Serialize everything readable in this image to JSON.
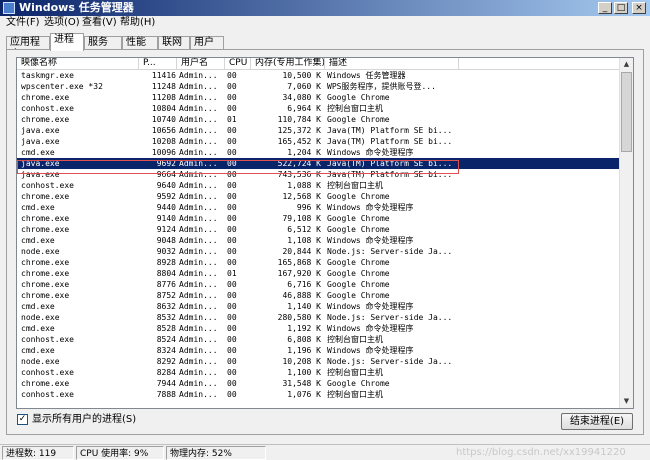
{
  "window": {
    "title": "Windows 任务管理器",
    "min_glyph": "_",
    "max_glyph": "□",
    "close_glyph": "×"
  },
  "menu": [
    "文件(F)",
    "选项(O)",
    "查看(V)",
    "帮助(H)"
  ],
  "tabs": [
    "应用程序",
    "进程",
    "服务",
    "性能",
    "联网",
    "用户"
  ],
  "table": {
    "headers": [
      "映像名称",
      "P...",
      "用户名",
      "CPU",
      "内存(专用工作集)",
      "描述"
    ],
    "rows": [
      {
        "name": "taskmgr.exe",
        "pid": "11416",
        "user": "Admin...",
        "cpu": "00",
        "mem": "10,500 K",
        "desc": "Windows 任务管理器"
      },
      {
        "name": "wpscenter.exe *32",
        "pid": "11248",
        "user": "Admin...",
        "cpu": "00",
        "mem": "7,060 K",
        "desc": "WPS服务程序，提供账号登..."
      },
      {
        "name": "chrome.exe",
        "pid": "11208",
        "user": "Admin...",
        "cpu": "00",
        "mem": "34,080 K",
        "desc": "Google Chrome"
      },
      {
        "name": "conhost.exe",
        "pid": "10804",
        "user": "Admin...",
        "cpu": "00",
        "mem": "6,964 K",
        "desc": "控制台窗口主机"
      },
      {
        "name": "chrome.exe",
        "pid": "10740",
        "user": "Admin...",
        "cpu": "01",
        "mem": "110,784 K",
        "desc": "Google Chrome"
      },
      {
        "name": "java.exe",
        "pid": "10656",
        "user": "Admin...",
        "cpu": "00",
        "mem": "125,372 K",
        "desc": "Java(TM) Platform SE bi..."
      },
      {
        "name": "java.exe",
        "pid": "10208",
        "user": "Admin...",
        "cpu": "00",
        "mem": "165,452 K",
        "desc": "Java(TM) Platform SE bi..."
      },
      {
        "name": "cmd.exe",
        "pid": "10096",
        "user": "Admin...",
        "cpu": "00",
        "mem": "1,204 K",
        "desc": "Windows 命令处理程序"
      },
      {
        "name": "java.exe",
        "pid": "9692",
        "user": "Admin...",
        "cpu": "00",
        "mem": "522,724 K",
        "desc": "Java(TM) Platform SE bi..."
      },
      {
        "name": "java.exe",
        "pid": "9664",
        "user": "Admin...",
        "cpu": "00",
        "mem": "743,536 K",
        "desc": "Java(TM) Platform SE bi..."
      },
      {
        "name": "conhost.exe",
        "pid": "9640",
        "user": "Admin...",
        "cpu": "00",
        "mem": "1,088 K",
        "desc": "控制台窗口主机"
      },
      {
        "name": "chrome.exe",
        "pid": "9592",
        "user": "Admin...",
        "cpu": "00",
        "mem": "12,568 K",
        "desc": "Google Chrome"
      },
      {
        "name": "cmd.exe",
        "pid": "9440",
        "user": "Admin...",
        "cpu": "00",
        "mem": "996 K",
        "desc": "Windows 命令处理程序"
      },
      {
        "name": "chrome.exe",
        "pid": "9140",
        "user": "Admin...",
        "cpu": "00",
        "mem": "79,108 K",
        "desc": "Google Chrome"
      },
      {
        "name": "chrome.exe",
        "pid": "9124",
        "user": "Admin...",
        "cpu": "00",
        "mem": "6,512 K",
        "desc": "Google Chrome"
      },
      {
        "name": "cmd.exe",
        "pid": "9048",
        "user": "Admin...",
        "cpu": "00",
        "mem": "1,108 K",
        "desc": "Windows 命令处理程序"
      },
      {
        "name": "node.exe",
        "pid": "9032",
        "user": "Admin...",
        "cpu": "00",
        "mem": "20,844 K",
        "desc": "Node.js: Server-side Ja..."
      },
      {
        "name": "chrome.exe",
        "pid": "8928",
        "user": "Admin...",
        "cpu": "00",
        "mem": "165,868 K",
        "desc": "Google Chrome"
      },
      {
        "name": "chrome.exe",
        "pid": "8804",
        "user": "Admin...",
        "cpu": "01",
        "mem": "167,920 K",
        "desc": "Google Chrome"
      },
      {
        "name": "chrome.exe",
        "pid": "8776",
        "user": "Admin...",
        "cpu": "00",
        "mem": "6,716 K",
        "desc": "Google Chrome"
      },
      {
        "name": "chrome.exe",
        "pid": "8752",
        "user": "Admin...",
        "cpu": "00",
        "mem": "46,888 K",
        "desc": "Google Chrome"
      },
      {
        "name": "cmd.exe",
        "pid": "8632",
        "user": "Admin...",
        "cpu": "00",
        "mem": "1,140 K",
        "desc": "Windows 命令处理程序"
      },
      {
        "name": "node.exe",
        "pid": "8532",
        "user": "Admin...",
        "cpu": "00",
        "mem": "280,580 K",
        "desc": "Node.js: Server-side Ja..."
      },
      {
        "name": "cmd.exe",
        "pid": "8528",
        "user": "Admin...",
        "cpu": "00",
        "mem": "1,192 K",
        "desc": "Windows 命令处理程序"
      },
      {
        "name": "conhost.exe",
        "pid": "8524",
        "user": "Admin...",
        "cpu": "00",
        "mem": "6,808 K",
        "desc": "控制台窗口主机"
      },
      {
        "name": "cmd.exe",
        "pid": "8324",
        "user": "Admin...",
        "cpu": "00",
        "mem": "1,196 K",
        "desc": "Windows 命令处理程序"
      },
      {
        "name": "node.exe",
        "pid": "8292",
        "user": "Admin...",
        "cpu": "00",
        "mem": "10,208 K",
        "desc": "Node.js: Server-side Ja..."
      },
      {
        "name": "conhost.exe",
        "pid": "8284",
        "user": "Admin...",
        "cpu": "00",
        "mem": "1,100 K",
        "desc": "控制台窗口主机"
      },
      {
        "name": "chrome.exe",
        "pid": "7944",
        "user": "Admin...",
        "cpu": "00",
        "mem": "31,548 K",
        "desc": "Google Chrome"
      },
      {
        "name": "conhost.exe",
        "pid": "7888",
        "user": "Admin...",
        "cpu": "00",
        "mem": "1,076 K",
        "desc": "控制台窗口主机"
      }
    ],
    "selected_pid": "9692"
  },
  "scroll": {
    "up_glyph": "▲",
    "down_glyph": "▼"
  },
  "show_all_users": {
    "label": "显示所有用户的进程(S)",
    "checked": true,
    "check_glyph": "✓"
  },
  "end_process_button": "结束进程(E)",
  "status": {
    "processes": "进程数: 119",
    "cpu": "CPU 使用率: 9%",
    "memory": "物理内存: 52%"
  },
  "watermark": "https://blog.csdn.net/xx19941220"
}
